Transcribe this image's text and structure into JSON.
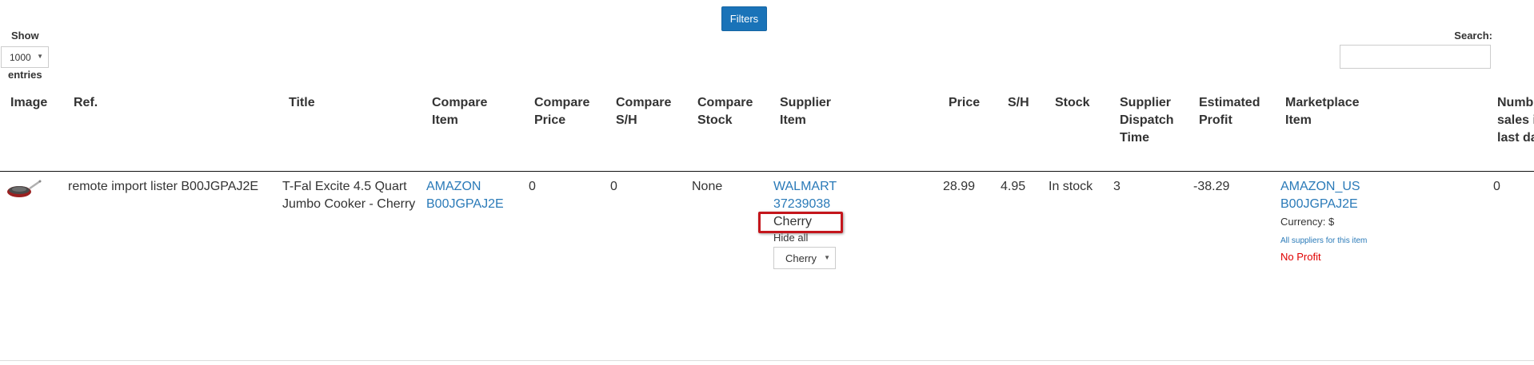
{
  "toolbar": {
    "filters_label": "Filters"
  },
  "length": {
    "show_label": "Show",
    "selected": "1000",
    "entries_label": "entries"
  },
  "search": {
    "label": "Search:",
    "value": "",
    "placeholder": ""
  },
  "columns": [
    "Image",
    "Ref.",
    "Title",
    "Compare Item",
    "Compare Price",
    "Compare S/H",
    "Compare Stock",
    "Supplier Item",
    "Price",
    "S/H",
    "Stock",
    "Supplier Dispatch Time",
    "Estimated Profit",
    "Marketplace Item",
    "Number of sales in last days"
  ],
  "row": {
    "image_icon": "pan-product-icon",
    "ref": "remote import lister B00JGPAJ2E",
    "title": "T-Fal Excite 4.5 Quart Jumbo Cooker - Cherry",
    "compare_item_source": "AMAZON",
    "compare_item_id": "B00JGPAJ2E",
    "compare_price": "0",
    "compare_sh": "0",
    "compare_stock": "None",
    "supplier_item_source": "WALMART",
    "supplier_item_id": "37239038",
    "supplier_variant": "Cherry",
    "hide_all_label": "Hide all",
    "variant_selected": "Cherry",
    "price": "28.99",
    "sh": "4.95",
    "stock": "In stock",
    "dispatch_time": "3",
    "estimated_profit": "-38.29",
    "marketplace_source": "AMAZON_US",
    "marketplace_id": "B00JGPAJ2E",
    "currency": "Currency: $",
    "all_suppliers_link": "All suppliers for this item",
    "profit_status": "No Profit",
    "sales_count": "0"
  },
  "colors": {
    "accent": "#1a73b8",
    "link": "#2a7ab8",
    "alert": "#e00000",
    "highlight": "#c4161c"
  }
}
